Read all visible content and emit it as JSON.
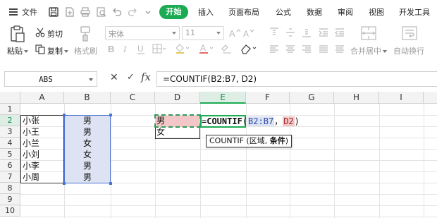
{
  "menubar": {
    "file_label": "文件",
    "tabs": [
      "开始",
      "插入",
      "页面布局",
      "公式",
      "数据",
      "审阅",
      "视图",
      "开发工具"
    ],
    "active_tab": "开始"
  },
  "ribbon": {
    "paste_label": "粘贴",
    "cut_label": "剪切",
    "copy_label": "复制",
    "format_painter_label": "格式刷",
    "font_name": "宋体",
    "font_size": "11",
    "merge_center_label": "合并居中",
    "auto_wrap_label": "自动换行"
  },
  "formula_bar": {
    "name_box": "ABS",
    "cancel_symbol": "✕",
    "confirm_symbol": "✓",
    "fx_label": "fx",
    "formula": "=COUNTIF(B2:B7, D2)"
  },
  "sheet": {
    "columns": [
      "A",
      "B",
      "C",
      "D",
      "E",
      "F",
      "G",
      "H",
      "I"
    ],
    "selected_column": "E",
    "rows": [
      "1",
      "2",
      "3",
      "4",
      "5",
      "6",
      "7",
      "8",
      "9",
      "10"
    ],
    "selected_row": "2",
    "col_a": [
      "小张",
      "小王",
      "小兰",
      "小刘",
      "小李",
      "小周"
    ],
    "col_b": [
      "男",
      "男",
      "女",
      "女",
      "男",
      "男"
    ],
    "col_d": [
      "男",
      "女"
    ],
    "edit_cell": {
      "eq": "=",
      "fn": "COUNTIF",
      "open": "(",
      "range": "B2:B7",
      "sep": "，",
      "crit": "D2",
      "close": ")"
    },
    "tooltip": {
      "prefix": "COUNTIF (区域, ",
      "current_arg": "条件",
      "suffix": ")"
    }
  },
  "colors": {
    "accent_green": "#1aab53",
    "range_blue": "#4a74d4",
    "criteria_red": "#f3c7c7"
  }
}
